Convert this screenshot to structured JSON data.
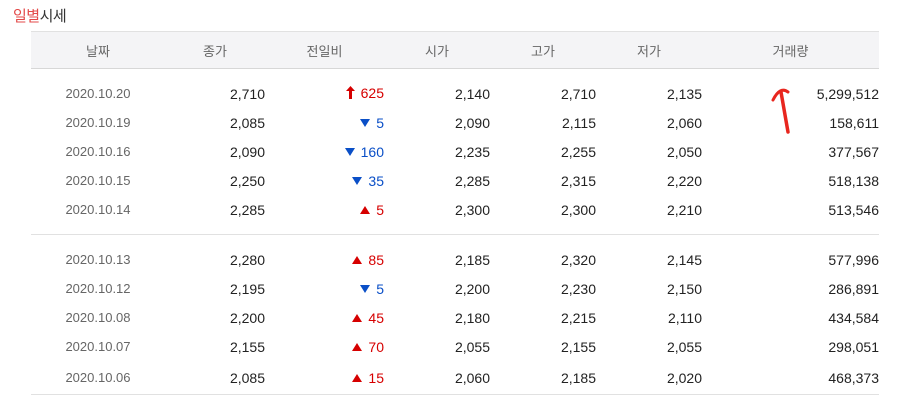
{
  "title": {
    "highlight": "일별",
    "rest": "시세"
  },
  "columns": [
    "날짜",
    "종가",
    "전일비",
    "시가",
    "고가",
    "저가",
    "거래량"
  ],
  "colors": {
    "up": "#d60000",
    "down": "#0a4fc7",
    "title_highlight": "#e34948"
  },
  "group1": [
    {
      "date": "2020.10.20",
      "close": "2,710",
      "dir": "upper-limit",
      "change": "625",
      "open": "2,140",
      "high": "2,710",
      "low": "2,135",
      "volume": "5,299,512"
    },
    {
      "date": "2020.10.19",
      "close": "2,085",
      "dir": "down",
      "change": "5",
      "open": "2,090",
      "high": "2,115",
      "low": "2,060",
      "volume": "158,611"
    },
    {
      "date": "2020.10.16",
      "close": "2,090",
      "dir": "down",
      "change": "160",
      "open": "2,235",
      "high": "2,255",
      "low": "2,050",
      "volume": "377,567"
    },
    {
      "date": "2020.10.15",
      "close": "2,250",
      "dir": "down",
      "change": "35",
      "open": "2,285",
      "high": "2,315",
      "low": "2,220",
      "volume": "518,138"
    },
    {
      "date": "2020.10.14",
      "close": "2,285",
      "dir": "up",
      "change": "5",
      "open": "2,300",
      "high": "2,300",
      "low": "2,210",
      "volume": "513,546"
    }
  ],
  "group2": [
    {
      "date": "2020.10.13",
      "close": "2,280",
      "dir": "up",
      "change": "85",
      "open": "2,185",
      "high": "2,320",
      "low": "2,145",
      "volume": "577,996"
    },
    {
      "date": "2020.10.12",
      "close": "2,195",
      "dir": "down",
      "change": "5",
      "open": "2,200",
      "high": "2,230",
      "low": "2,150",
      "volume": "286,891"
    },
    {
      "date": "2020.10.08",
      "close": "2,200",
      "dir": "up",
      "change": "45",
      "open": "2,180",
      "high": "2,215",
      "low": "2,110",
      "volume": "434,584"
    },
    {
      "date": "2020.10.07",
      "close": "2,155",
      "dir": "up",
      "change": "70",
      "open": "2,055",
      "high": "2,155",
      "low": "2,055",
      "volume": "298,051"
    },
    {
      "date": "2020.10.06",
      "close": "2,085",
      "dir": "up",
      "change": "15",
      "open": "2,060",
      "high": "2,185",
      "low": "2,020",
      "volume": "468,373"
    }
  ]
}
